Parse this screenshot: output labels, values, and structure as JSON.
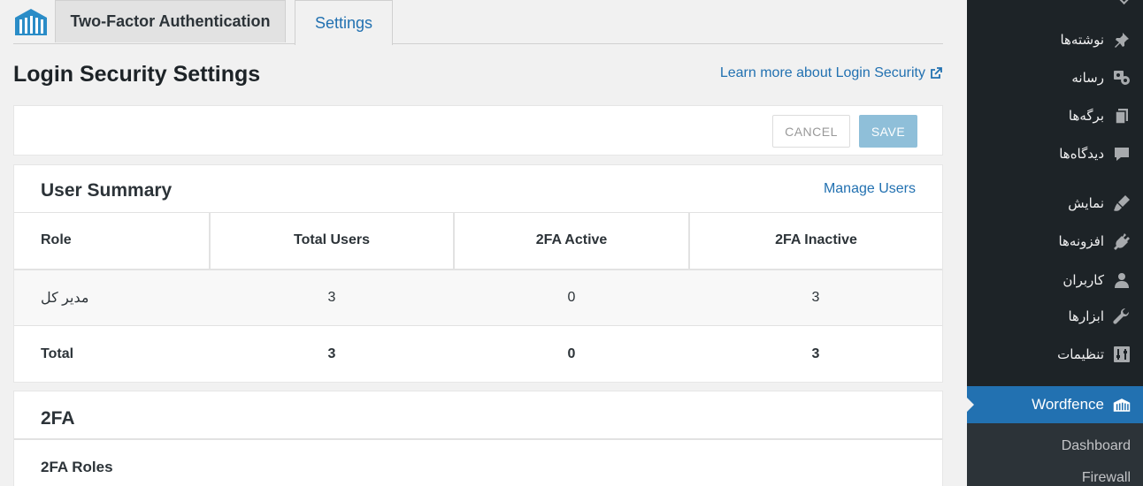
{
  "tabs": {
    "two_factor": "Two-Factor Authentication",
    "settings": "Settings"
  },
  "page": {
    "title": "Login Security Settings",
    "learn_more": "Learn more about Login Security"
  },
  "actions": {
    "cancel": "CANCEL",
    "save": "SAVE"
  },
  "summary": {
    "title": "User Summary",
    "manage_users": "Manage Users",
    "columns": [
      "Role",
      "Total Users",
      "2FA Active",
      "2FA Inactive"
    ],
    "rows": [
      {
        "role": "مدیر کل",
        "total": "3",
        "active": "0",
        "inactive": "3"
      }
    ],
    "total_row": {
      "role": "Total",
      "total": "3",
      "active": "0",
      "inactive": "3"
    }
  },
  "twofa": {
    "title": "2FA",
    "roles_label": "2FA Roles"
  },
  "sidebar": {
    "items": [
      {
        "label": "نوشته‌ها",
        "icon": "pin-icon"
      },
      {
        "label": "رسانه",
        "icon": "media-icon"
      },
      {
        "label": "برگه‌ها",
        "icon": "pages-icon"
      },
      {
        "label": "دیدگاه‌ها",
        "icon": "comments-icon"
      },
      {
        "label": "نمایش",
        "icon": "appearance-icon"
      },
      {
        "label": "افزونه‌ها",
        "icon": "plugins-icon"
      },
      {
        "label": "کاربران",
        "icon": "users-icon"
      },
      {
        "label": "ابزارها",
        "icon": "tools-icon"
      },
      {
        "label": "تنظیمات",
        "icon": "settings-icon"
      }
    ],
    "active": {
      "label": "Wordfence",
      "icon": "wordfence-icon"
    },
    "submenu": [
      "Dashboard",
      "Firewall"
    ]
  },
  "colors": {
    "link": "#2271b1",
    "sidebar_bg": "#1d2327",
    "active_bg": "#2271b1",
    "save_btn": "#8fbfd9"
  }
}
